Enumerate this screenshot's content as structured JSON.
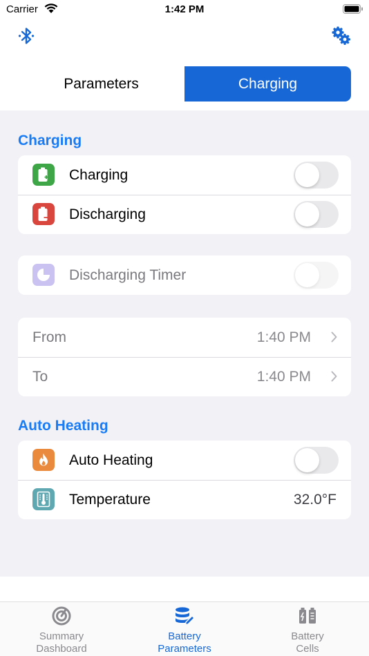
{
  "status_bar": {
    "carrier": "Carrier",
    "time": "1:42 PM"
  },
  "header": {
    "bluetooth_icon": "bluetooth-icon",
    "settings_icon": "gears-icon"
  },
  "segmented": {
    "tabs": [
      "Parameters",
      "Charging"
    ],
    "selected": "Charging"
  },
  "sections": {
    "charging": {
      "title": "Charging",
      "rows": [
        {
          "label": "Charging",
          "icon": "battery-plus-icon",
          "icon_color": "#3fa648",
          "on": false
        },
        {
          "label": "Discharging",
          "icon": "battery-minus-icon",
          "icon_color": "#d9463e",
          "on": false
        }
      ]
    },
    "timer": {
      "label": "Discharging Timer",
      "icon": "timer-icon",
      "icon_color": "#8b7ae0",
      "on": false,
      "enabled": false
    },
    "time_range": {
      "rows": [
        {
          "label": "From",
          "value": "1:40 PM"
        },
        {
          "label": "To",
          "value": "1:40 PM"
        }
      ]
    },
    "heating": {
      "title": "Auto Heating",
      "rows": [
        {
          "label": "Auto Heating",
          "icon": "flame-icon",
          "icon_color": "#ea8a3c",
          "on": false
        },
        {
          "label": "Temperature",
          "icon": "thermometer-icon",
          "icon_color": "#5fa8b2",
          "value": "32.0°F"
        }
      ]
    }
  },
  "tab_bar": {
    "active_color": "#1768d6",
    "tabs": [
      {
        "line1": "Summary",
        "line2": "Dashboard",
        "icon": "dashboard-icon",
        "active": false
      },
      {
        "line1": "Battery",
        "line2": "Parameters",
        "icon": "database-edit-icon",
        "active": true
      },
      {
        "line1": "Battery",
        "line2": "Cells",
        "icon": "battery-cells-icon",
        "active": false
      }
    ]
  }
}
